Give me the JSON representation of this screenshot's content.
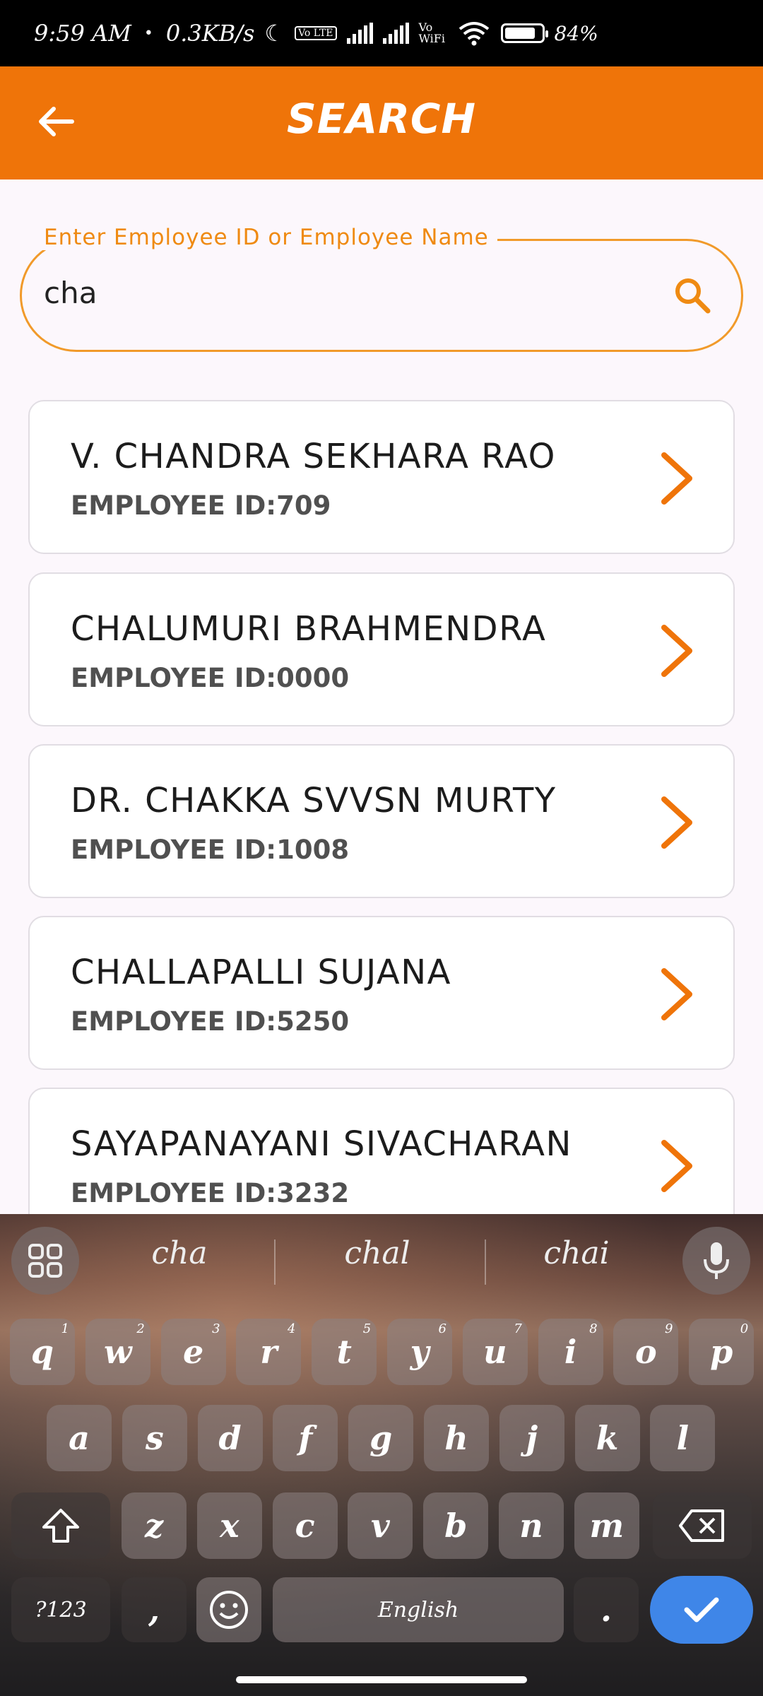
{
  "status_bar": {
    "time": "9:59 AM",
    "dot": "•",
    "speed": "0.3KB/s",
    "volte": "Vo LTE",
    "vowifi": "Vo WiFi",
    "battery_pct": "84%",
    "battery_level": 0.84
  },
  "appbar": {
    "title": "SEARCH"
  },
  "search": {
    "label": "Enter Employee ID or Employee Name",
    "value": "cha"
  },
  "results": [
    {
      "name": "V. CHANDRA SEKHARA RAO",
      "employee_id": "EMPLOYEE ID:709"
    },
    {
      "name": "CHALUMURI BRAHMENDRA",
      "employee_id": "EMPLOYEE ID:0000"
    },
    {
      "name": "DR. CHAKKA SVVSN MURTY",
      "employee_id": "EMPLOYEE ID:1008"
    },
    {
      "name": "CHALLAPALLI SUJANA",
      "employee_id": "EMPLOYEE ID:5250"
    },
    {
      "name": "SAYAPANAYANI SIVACHARAN",
      "employee_id": "EMPLOYEE ID:3232"
    }
  ],
  "keyboard": {
    "suggestions": [
      "cha",
      "chal",
      "chai"
    ],
    "row1": [
      "q",
      "w",
      "e",
      "r",
      "t",
      "y",
      "u",
      "i",
      "o",
      "p"
    ],
    "row1_hints": [
      "1",
      "2",
      "3",
      "4",
      "5",
      "6",
      "7",
      "8",
      "9",
      "0"
    ],
    "row2": [
      "a",
      "s",
      "d",
      "f",
      "g",
      "h",
      "j",
      "k",
      "l"
    ],
    "row3": [
      "z",
      "x",
      "c",
      "v",
      "b",
      "n",
      "m"
    ],
    "symbols_label": "?123",
    "comma": ",",
    "space_label": "English",
    "period": "."
  },
  "colors": {
    "accent": "#ef7409",
    "enter": "#3f86e8"
  }
}
